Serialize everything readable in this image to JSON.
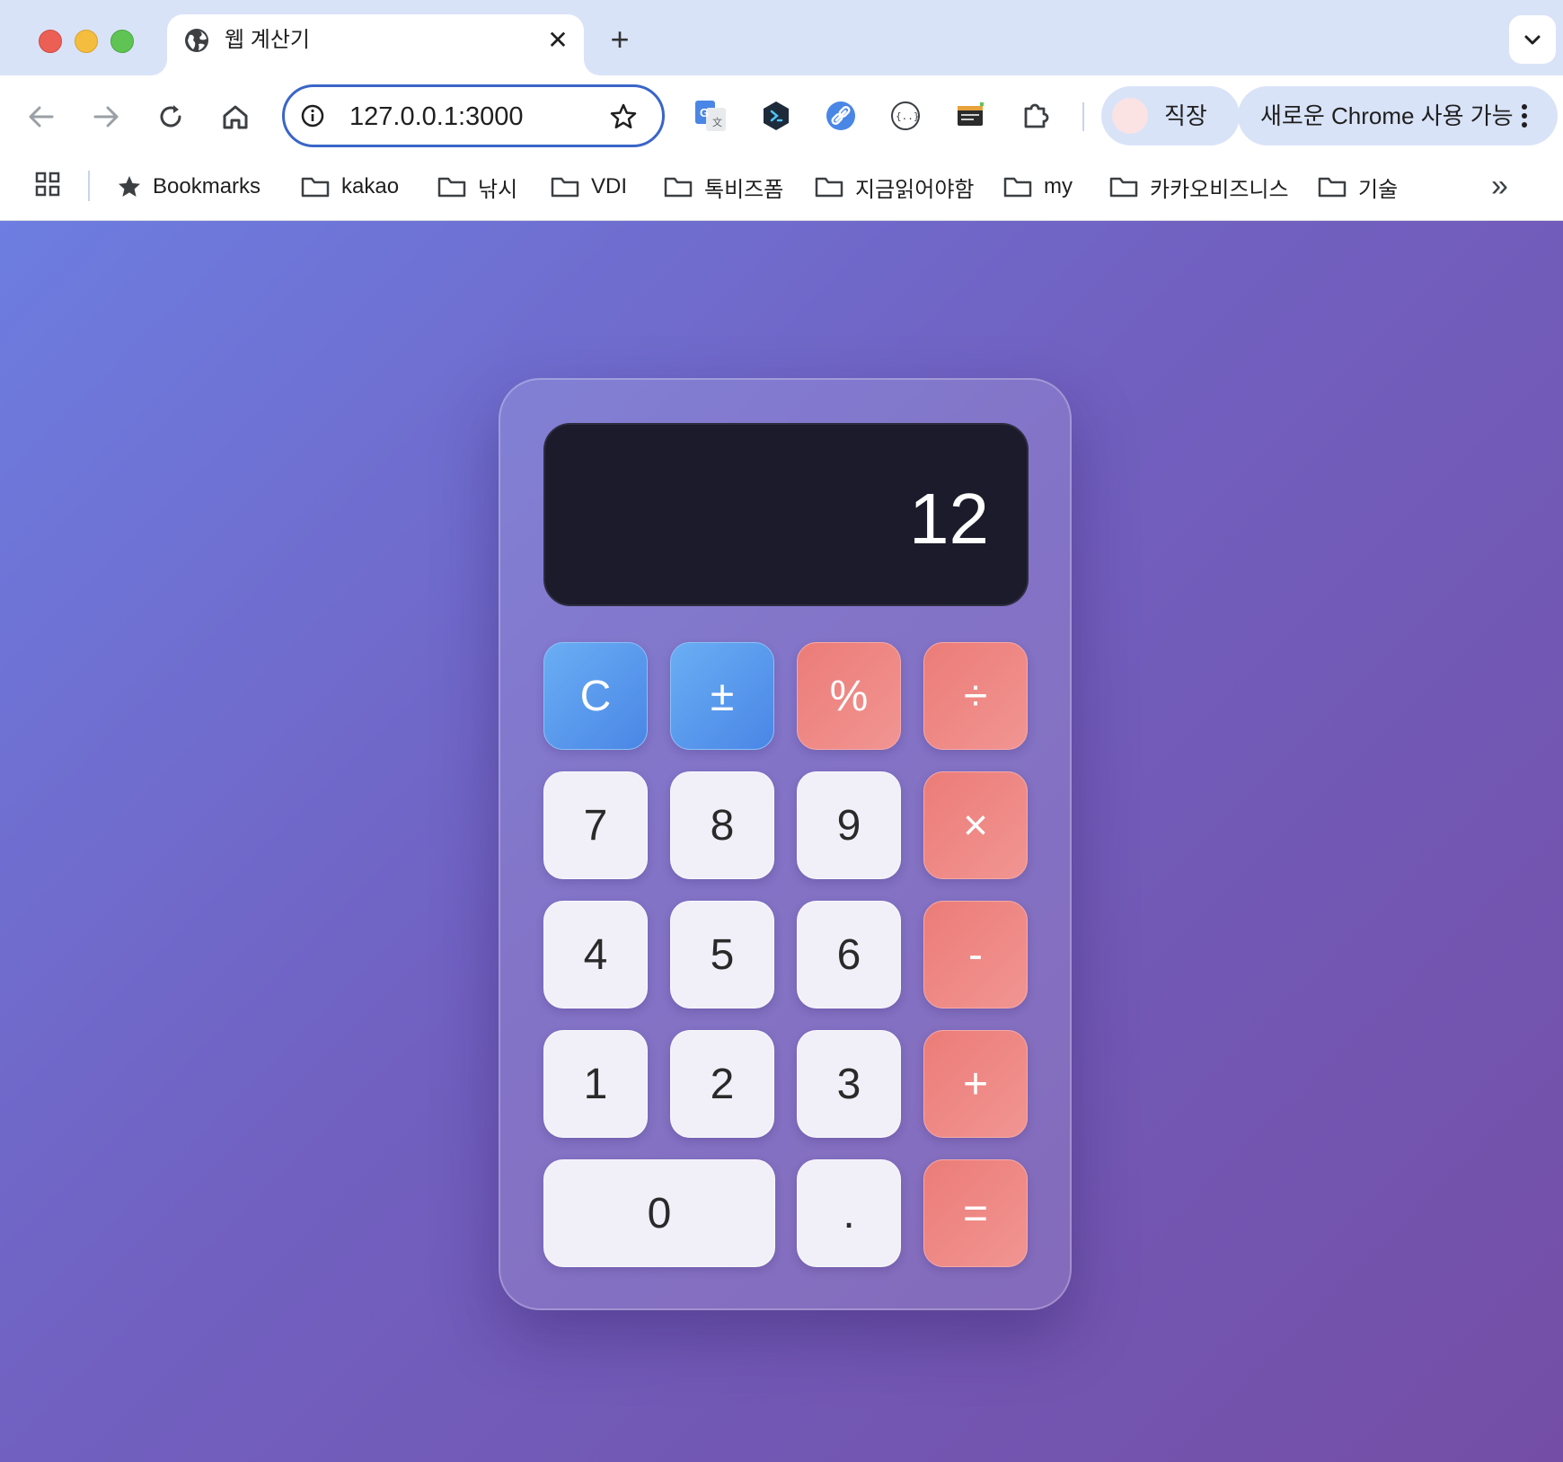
{
  "browser": {
    "tab": {
      "title": "웹 계산기",
      "close_glyph": "✕",
      "favicon": "globe-icon"
    },
    "new_tab_glyph": "+",
    "omnibox": {
      "url": "127.0.0.1:3000"
    },
    "profile": {
      "label": "직장"
    },
    "update": {
      "label": "새로운 Chrome 사용 가능"
    },
    "bookmarks": [
      {
        "label": "Bookmarks",
        "icon": "star-icon"
      },
      {
        "label": "kakao",
        "icon": "folder-icon"
      },
      {
        "label": "낚시",
        "icon": "folder-icon"
      },
      {
        "label": "VDI",
        "icon": "folder-icon"
      },
      {
        "label": "톡비즈폼",
        "icon": "folder-icon"
      },
      {
        "label": "지금읽어야함",
        "icon": "folder-icon"
      },
      {
        "label": "my",
        "icon": "folder-icon"
      },
      {
        "label": "카카오비즈니스",
        "icon": "folder-icon"
      },
      {
        "label": "기술",
        "icon": "folder-icon"
      }
    ],
    "bookmarks_overflow": "»",
    "colors": {
      "tabstrip": "#d9e3f8",
      "omnibox_border": "#3a65c8"
    }
  },
  "calculator": {
    "display": "12",
    "keys": {
      "clear": "C",
      "sign": "±",
      "percent": "%",
      "divide": "÷",
      "seven": "7",
      "eight": "8",
      "nine": "9",
      "multiply": "×",
      "four": "4",
      "five": "5",
      "six": "6",
      "subtract": "-",
      "one": "1",
      "two": "2",
      "three": "3",
      "add": "+",
      "zero": "0",
      "decimal": ".",
      "equals": "="
    },
    "colors": {
      "function_keys": "#4a86e6",
      "operator_keys": "#ec7c78",
      "number_keys": "#f1f0f8",
      "display_bg": "#1c1b2b",
      "background_start": "#6d7de0",
      "background_end": "#744ea6"
    }
  }
}
